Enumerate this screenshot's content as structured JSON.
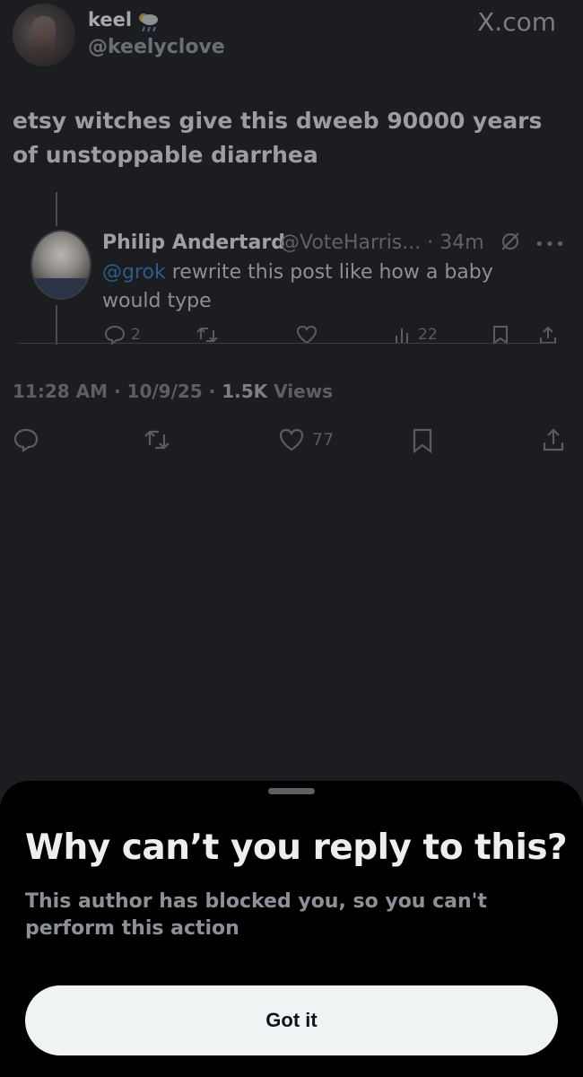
{
  "header": {
    "name": "keel",
    "handle": "@keelyclove",
    "site_label": "X.com",
    "weather_icon": "cloud-rain-icon"
  },
  "post": {
    "text": "etsy witches give this dweeb 90000 years of unstoppable diarrhea",
    "timestamp": "11:28 AM · 10/9/25 ·",
    "views_count": "1.5K",
    "views_label": "Views",
    "likes": "77"
  },
  "quoted": {
    "name": "Philip Andertard",
    "handle_time": "@VoteHarris... · 34m",
    "mention": "@grok",
    "text": " rewrite this post like how a baby would type",
    "replies": "2",
    "views": "22"
  },
  "sheet": {
    "title": "Why can’t you reply to this?",
    "body": "This author has blocked you, so you can't perform this action",
    "button_label": "Got it"
  },
  "colors": {
    "background": "#1c1d20",
    "sheet_background": "#000000",
    "button_background": "#eff3f4",
    "mention": "#1d9bf0"
  }
}
